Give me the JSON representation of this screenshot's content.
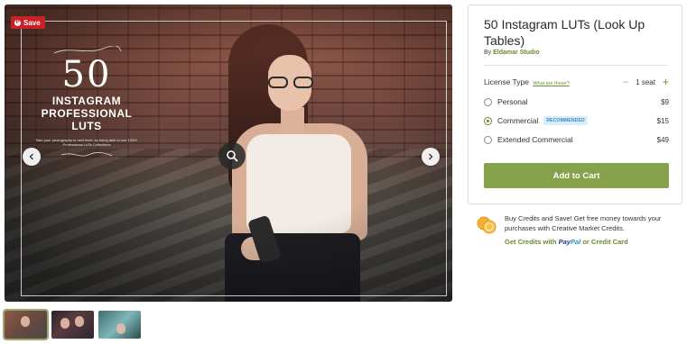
{
  "gallery": {
    "save_label": "Save",
    "overlay": {
      "number": "50",
      "line1": "INSTAGRAM",
      "line2": "PROFESSIONAL LUTS",
      "tagline": "Take your photography to next level, by being able to use 1000+ Professional LUTs Collections"
    },
    "thumbnails_count": 3
  },
  "product": {
    "title": "50 Instagram LUTs (Look Up Tables)",
    "by_prefix": "By",
    "author": "Eldamar Studio"
  },
  "license": {
    "label": "License Type",
    "help_link": "What are these?",
    "seat_value": "1 seat",
    "options": [
      {
        "name": "Personal",
        "price": "$9",
        "selected": false
      },
      {
        "name": "Commercial",
        "price": "$15",
        "selected": true,
        "badge": "RECOMMENDED"
      },
      {
        "name": "Extended Commercial",
        "price": "$49",
        "selected": false
      }
    ]
  },
  "cart": {
    "button_label": "Add to Cart"
  },
  "credits": {
    "text": "Buy Credits and Save! Get free money towards your purchases with Creative Market Credits.",
    "link_prefix": "Get Credits with",
    "paypal_1": "Pay",
    "paypal_2": "Pal",
    "link_suffix": "or Credit Card"
  },
  "colors": {
    "accent": "#85a24a",
    "link": "#6d8a2e",
    "save_badge": "#cb2027",
    "recommended_bg": "#d9eefb"
  }
}
